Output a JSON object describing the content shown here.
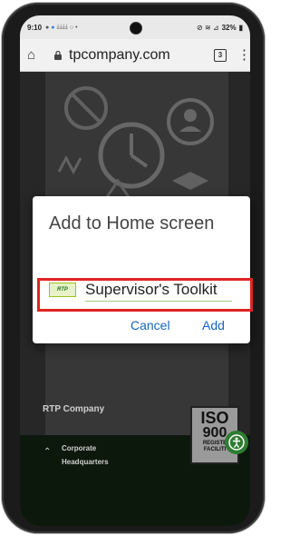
{
  "status_bar": {
    "time": "9:10",
    "battery": "32%"
  },
  "browser": {
    "url": "tpcompany.com",
    "tab_count": "3"
  },
  "page": {
    "company_name": "RTP Company",
    "headquarters_line1": "Corporate",
    "headquarters_line2": "Headquarters",
    "iso_line1": "ISO",
    "iso_line2": "900",
    "iso_line3": "REGISTE",
    "iso_line4": "FACILITI"
  },
  "dialog": {
    "title": "Add to Home screen",
    "app_icon_text": "RTP",
    "app_name_value": "Supervisor's Toolkit",
    "cancel_label": "Cancel",
    "add_label": "Add"
  },
  "colors": {
    "accent": "#1565c0",
    "highlight": "#e02424"
  }
}
